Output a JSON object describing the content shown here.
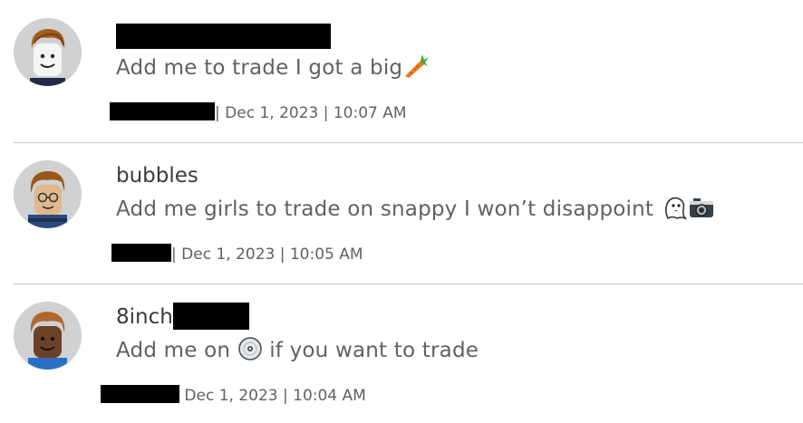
{
  "comments": [
    {
      "author": "",
      "message": "Add me to trade I got a big",
      "emoji": "carrot-icon",
      "separator": "|",
      "date": "Dec 1, 2023 | 10:07 AM"
    },
    {
      "author": "bubbles",
      "message": "Add me girls to trade on snappy I won’t disappoint",
      "emoji": "ghost-and-camera-icons",
      "separator": "|",
      "date": "Dec 1, 2023 | 10:05 AM"
    },
    {
      "author": "8inch",
      "message_before": "Add me on",
      "message_after": "if you want to trade",
      "emoji": "disc-icon",
      "date": "Dec 1, 2023 | 10:04 AM"
    }
  ]
}
